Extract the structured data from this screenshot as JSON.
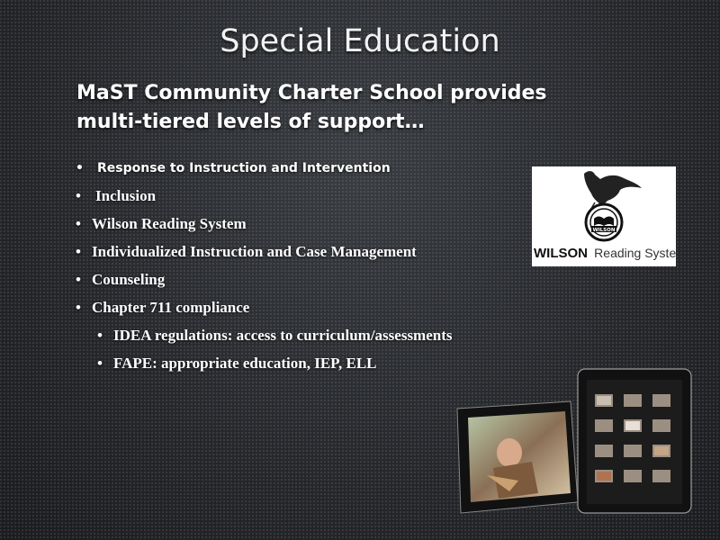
{
  "slide": {
    "title": "Special Education",
    "subtitle_line1": "MaST Community Charter School provides",
    "subtitle_line2": "multi-tiered  levels of support…",
    "bullets": [
      "Response to Instruction and Intervention",
      "Inclusion",
      "Wilson Reading System",
      "Individualized Instruction and Case Management",
      "Counseling",
      "Chapter 711 compliance"
    ],
    "sub_bullets": [
      "IDEA regulations: access to curriculum/assessments",
      "FAPE: appropriate education, IEP, ELL"
    ],
    "bullet_glyph": "•"
  },
  "logo": {
    "brand": "WILSON",
    "suffix": "Reading System",
    "badge": "WILSON",
    "mark": "®"
  },
  "colors": {
    "background": "#2a2c30",
    "text": "#ffffff"
  }
}
